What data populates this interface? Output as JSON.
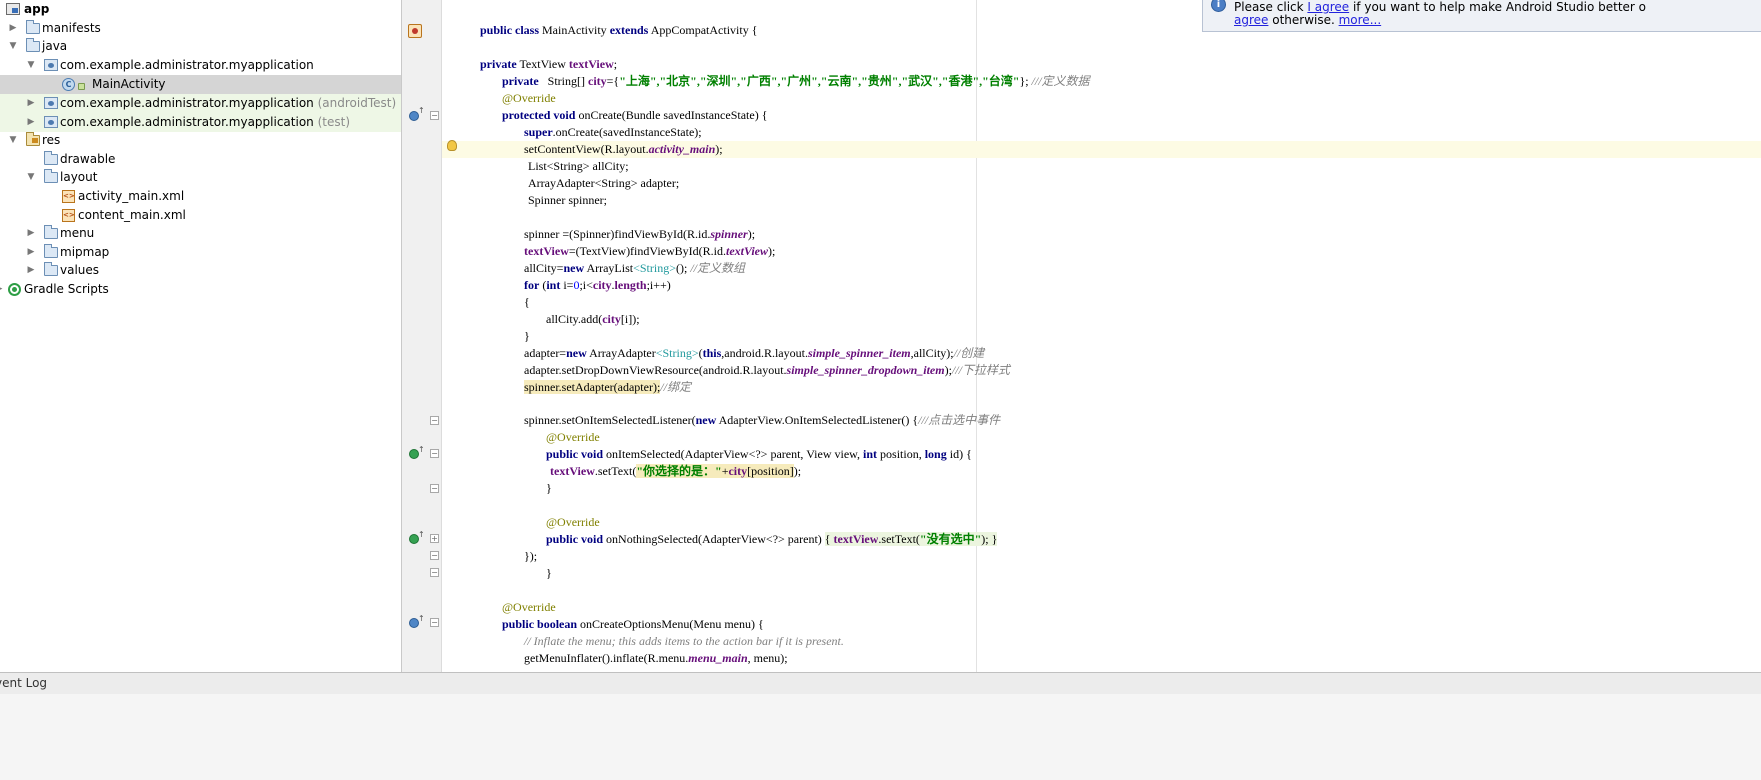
{
  "project_tree": {
    "rows": [
      {
        "label": "app",
        "bold": true,
        "icon": "module-icon"
      },
      {
        "label": "manifests",
        "icon": "folder-icon"
      },
      {
        "label": "java",
        "icon": "folder-icon"
      },
      {
        "label": "com.example.administrator.myapplication",
        "icon": "package-icon"
      },
      {
        "label": "MainActivity",
        "icon": "class-icon",
        "selected": true
      },
      {
        "label": "com.example.administrator.myapplication",
        "suffix": "(androidTest)",
        "icon": "package-icon"
      },
      {
        "label": "com.example.administrator.myapplication",
        "suffix": "(test)",
        "icon": "package-icon"
      },
      {
        "label": "res",
        "icon": "resource-folder-icon"
      },
      {
        "label": "drawable",
        "icon": "folder-icon"
      },
      {
        "label": "layout",
        "icon": "folder-icon"
      },
      {
        "label": "activity_main.xml",
        "icon": "xml-file-icon"
      },
      {
        "label": "content_main.xml",
        "icon": "xml-file-icon"
      },
      {
        "label": "menu",
        "icon": "folder-icon"
      },
      {
        "label": "mipmap",
        "icon": "folder-icon"
      },
      {
        "label": "values",
        "icon": "folder-icon"
      },
      {
        "label": "Gradle Scripts",
        "icon": "gradle-icon"
      }
    ]
  },
  "editor": {
    "code": {
      "l01": "public class",
      "l01b": " MainActivity ",
      "l01c": "extends",
      "l01d": " AppCompatActivity {",
      "l02a": "private",
      "l02b": " TextView ",
      "l02c": "textView",
      "l02d": ";",
      "l03a": "private",
      "l03b": "   String[] ",
      "l03c": "city",
      "l03d": "={",
      "l03e": "\"上海\",\"北京\",\"深圳\",\"广西\",\"广州\",\"云南\",\"贵州\",\"武汉\",\"香港\",\"台湾\"",
      "l03f": "}; ",
      "l03g": "///定义数据",
      "l04": "@Override",
      "l05a": "protected void",
      "l05b": " onCreate(Bundle savedInstanceState) {",
      "l06a": "super",
      "l06b": ".onCreate(savedInstanceState);",
      "l07a": "setContentView(R.layout.",
      "l07b": "activity_main",
      "l07c": ");",
      "l08": "List<String> allCity;",
      "l09": "ArrayAdapter<String> adapter;",
      "l10": "Spinner spinner;",
      "l11a": "spinner =(Spinner)findViewById(R.id.",
      "l11b": "spinner",
      "l11c": ");",
      "l12a": "textView",
      "l12b": "=(TextView)findViewById(R.id.",
      "l12c": "textView",
      "l12d": ");",
      "l13a": "allCity=",
      "l13b": "new",
      "l13c": " ArrayList",
      "l13d": "<String>",
      "l13e": "(); ",
      "l13f": "//定义数组",
      "l14a": "for",
      "l14b": " (",
      "l14c": "int",
      "l14d": " i=",
      "l14e": "0",
      "l14f": ";i<",
      "l14g": "city",
      "l14h": ".",
      "l14i": "length",
      "l14j": ";i++)",
      "l15": "{",
      "l16a": "allCity.add(",
      "l16b": "city",
      "l16c": "[i]);",
      "l17": "}",
      "l18a": "adapter=",
      "l18b": "new",
      "l18c": " ArrayAdapter",
      "l18d": "<String>",
      "l18e": "(",
      "l18f": "this",
      "l18g": ",android.R.layout.",
      "l18h": "simple_spinner_item",
      "l18i": ",allCity);",
      "l18j": "//创建",
      "l19a": "adapter.setDropDownViewResource(android.R.layout.",
      "l19b": "simple_spinner_dropdown_item",
      "l19c": ");",
      "l19d": "///下拉样式",
      "l20a": "spinner.setAdapter(adapter);",
      "l20b": "//绑定",
      "l21a": "spinner.setOnItemSelectedListener(",
      "l21b": "new",
      "l21c": " AdapterView.OnItemSelectedListener() {",
      "l21d": "///点击选中事件",
      "l22": "@Override",
      "l23a": "public void",
      "l23b": " onItemSelected(AdapterView<?> parent, View view, ",
      "l23c": "int",
      "l23d": " position, ",
      "l23e": "long",
      "l23f": " id) {",
      "l24a": "textView",
      "l24b": ".setText(",
      "l24c": "\"你选择的是：\"",
      "l24d": "+",
      "l24e": "city",
      "l24f": "[position]",
      "l24g": ");",
      "l25": "}",
      "l26": "@Override",
      "l27a": "public void",
      "l27b": " onNothingSelected(AdapterView<?> parent) ",
      "l27c": "{ ",
      "l27d": "textView",
      "l27e": ".setText(",
      "l27f": "\"没有选中\"",
      "l27g": "); }",
      "l28": "});",
      "l29": "}",
      "l30": "@Override",
      "l31a": "public boolean",
      "l31b": " onCreateOptionsMenu(Menu menu) {",
      "l32": "// Inflate the menu; this adds items to the action bar if it is present.",
      "l33a": "getMenuInflater().inflate(R.menu.",
      "l33b": "menu_main",
      "l33c": ", menu);"
    }
  },
  "notification": {
    "line1_prefix": "Please click ",
    "agree_link": "I agree",
    "line1_suffix": " if you want to help make Android Studio better o",
    "line2_link": "agree",
    "line2_text": " otherwise. ",
    "more_link": "more..."
  },
  "status_bar": {
    "event_log": "vent Log"
  }
}
